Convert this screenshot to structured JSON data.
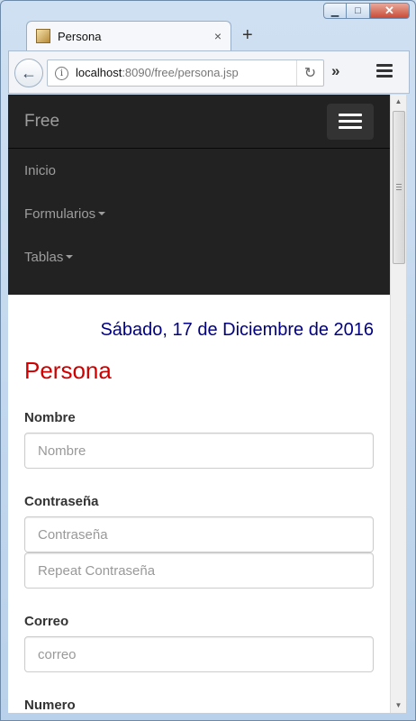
{
  "browser": {
    "tab_title": "Persona",
    "tab_close": "×",
    "new_tab": "+",
    "url_host": "localhost",
    "url_rest": ":8090/free/persona.jsp",
    "overflow": "»",
    "caption": {
      "minimize": "▁",
      "maximize": "□",
      "close": "✕"
    }
  },
  "navbar": {
    "brand": "Free",
    "items": [
      {
        "label": "Inicio",
        "dropdown": false
      },
      {
        "label": "Formularios",
        "dropdown": true
      },
      {
        "label": "Tablas",
        "dropdown": true
      }
    ]
  },
  "content": {
    "date": "Sábado, 17 de Diciembre de 2016",
    "title": "Persona",
    "fields": {
      "nombre_label": "Nombre",
      "nombre_placeholder": "Nombre",
      "password_label": "Contraseña",
      "password_placeholder": "Contraseña",
      "repeat_placeholder": "Repeat Contraseña",
      "correo_label": "Correo",
      "correo_placeholder": "correo",
      "numero_label": "Numero"
    }
  },
  "colors": {
    "date": "#000080",
    "title": "#d00000",
    "navbar_bg": "#222222"
  }
}
